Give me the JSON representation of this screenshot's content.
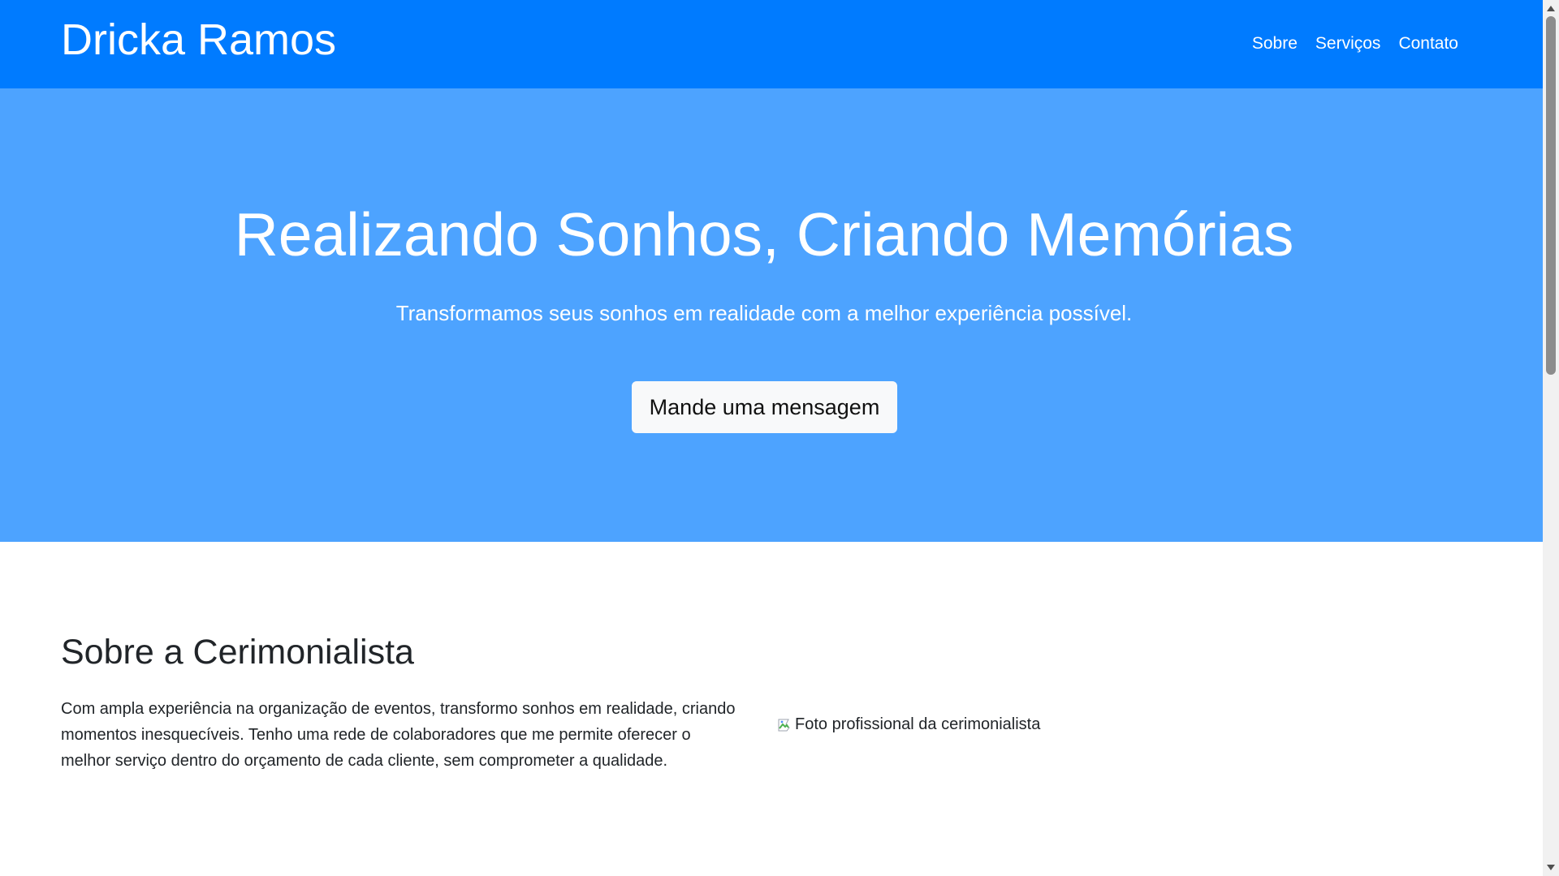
{
  "header": {
    "brand": "Dricka Ramos",
    "nav": [
      {
        "label": "Sobre"
      },
      {
        "label": "Serviços"
      },
      {
        "label": "Contato"
      }
    ]
  },
  "hero": {
    "title": "Realizando Sonhos, Criando Memórias",
    "subtitle": "Transformamos seus sonhos em realidade com a melhor experiência possível.",
    "button_label": "Mande uma mensagem"
  },
  "about": {
    "title": "Sobre a Cerimonialista",
    "text": "Com ampla experiência na organização de eventos, transformo sonhos em realidade, criando momentos inesquecíveis. Tenho uma rede de colaboradores que me permite oferecer o melhor serviço dentro do orçamento de cada cliente, sem comprometer a qualidade.",
    "image_alt": "Foto profissional da cerimonialista"
  },
  "colors": {
    "navbar_bg": "#007bff",
    "hero_bg": "#4da3ff",
    "button_bg": "#f8f9fa",
    "text": "#212529"
  },
  "icons": {
    "image_placeholder": "broken-image-icon"
  }
}
